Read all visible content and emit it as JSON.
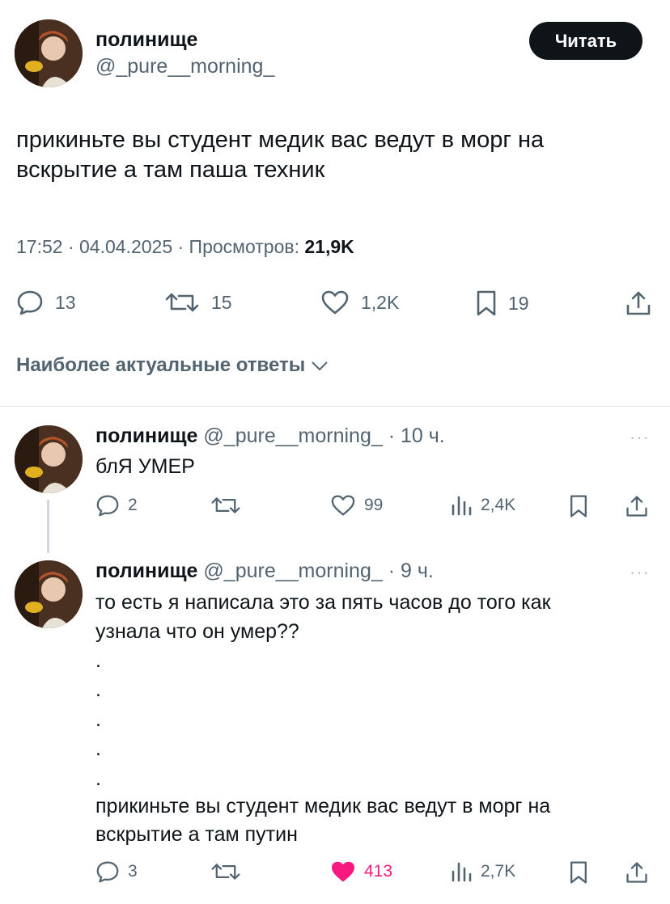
{
  "tweet": {
    "author_name": "полинище",
    "author_handle": "@_pure__morning_",
    "follow_label": "Читать",
    "text": "прикиньте вы студент медик вас ведут в морг на вскрытие а там паша техник",
    "time_date": "17:52 · 04.04.2025 · Просмотров: ",
    "views": "21,9K",
    "stats": {
      "replies": "13",
      "retweets": "15",
      "likes": "1,2K",
      "bookmarks": "19"
    }
  },
  "sort_label": "Наиболее актуальные ответы",
  "replies": [
    {
      "author_name": "полинище",
      "author_handle": "@_pure__morning_",
      "time": "· 10 ч.",
      "text": "блЯ УМЕР",
      "stats": {
        "replies": "2",
        "retweets": "",
        "likes": "99",
        "views": "2,4K"
      }
    },
    {
      "author_name": "полинище",
      "author_handle": "@_pure__morning_",
      "time": "· 9 ч.",
      "text_lines": [
        "то есть я написала это за пять часов до того как",
        "узнала что он умер??"
      ],
      "dots": [
        ".",
        ".",
        ".",
        ".",
        "."
      ],
      "text_end_lines": [
        "прикиньте вы студент медик вас ведут в морг на",
        "вскрытие а там путин"
      ],
      "stats": {
        "replies": "3",
        "retweets": "",
        "likes": "413",
        "views": "2,7K"
      }
    }
  ],
  "more_label": "···",
  "colors": {
    "text": "#0f1419",
    "secondary": "#536471",
    "like": "#f91880",
    "button": "#0f1419"
  }
}
